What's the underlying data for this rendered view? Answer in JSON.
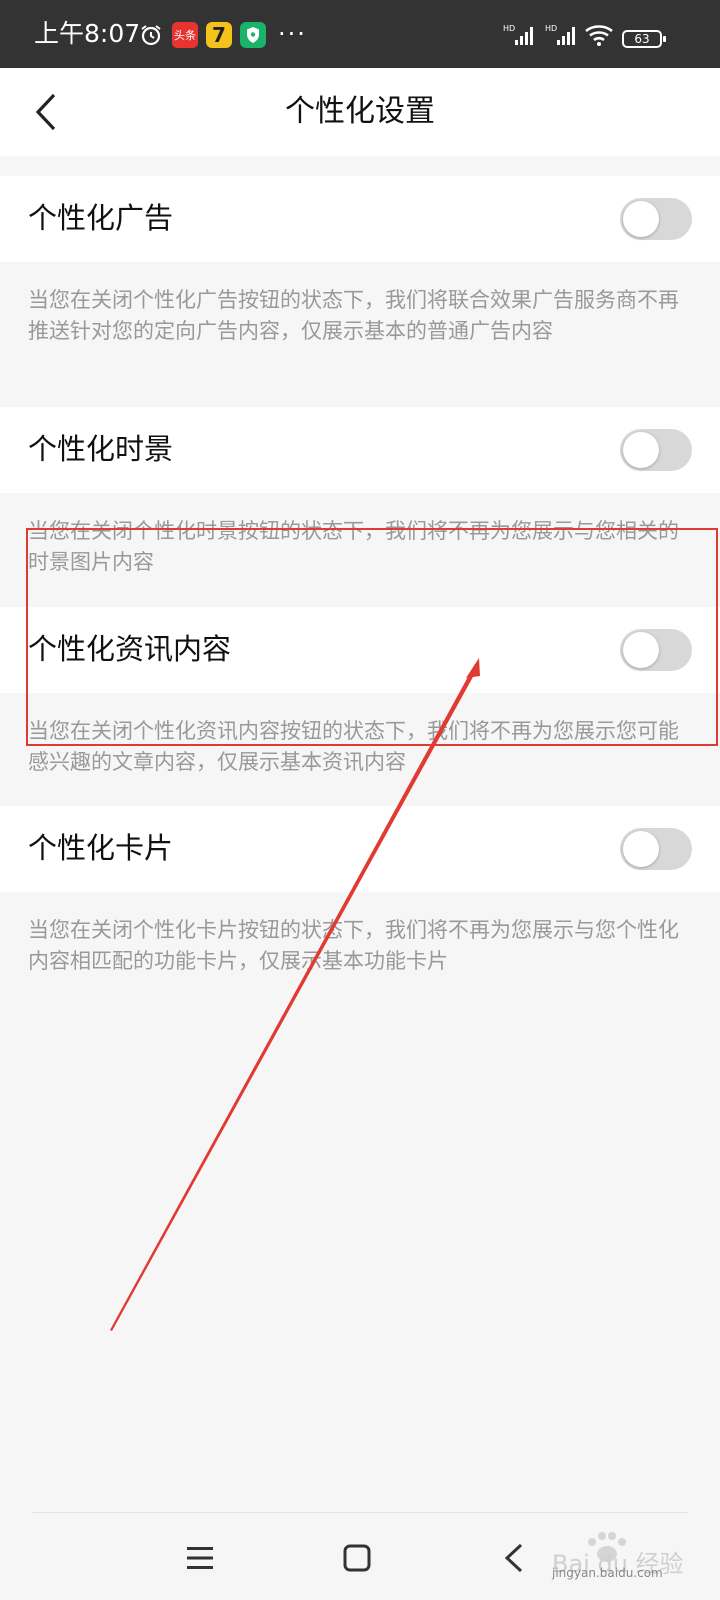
{
  "status_bar": {
    "time": "上午8:07",
    "app_badge": "头条",
    "app_badge2": "7",
    "more": "···",
    "battery": "63",
    "icons": [
      "alarm-icon",
      "toutiao-app-icon",
      "qimao-app-icon",
      "shield-app-icon",
      "signal-hd-icon",
      "signal-hd-icon",
      "wifi-icon",
      "battery-icon"
    ]
  },
  "header": {
    "title": "个性化设置",
    "back_icon": "chevron-left-icon"
  },
  "settings": [
    {
      "label": "个性化广告",
      "enabled": false,
      "description": "当您在关闭个性化广告按钮的状态下，我们将联合效果广告服务商不再推送针对您的定向广告内容，仅展示基本的普通广告内容"
    },
    {
      "label": "个性化时景",
      "enabled": false,
      "description": "当您在关闭个性化时景按钮的状态下，我们将不再为您展示与您相关的时景图片内容"
    },
    {
      "label": "个性化资讯内容",
      "enabled": false,
      "description": "当您在关闭个性化资讯内容按钮的状态下，我们将不再为您展示您可能感兴趣的文章内容，仅展示基本资讯内容"
    },
    {
      "label": "个性化卡片",
      "enabled": false,
      "description": "当您在关闭个性化卡片按钮的状态下，我们将不再为您展示与您个性化内容相匹配的功能卡片，仅展示基本功能卡片"
    }
  ],
  "nav_bar": {
    "icons": [
      "menu-icon",
      "home-square-icon",
      "back-chevron-icon"
    ]
  },
  "watermark": {
    "brand": "Bai du 经验",
    "url": "jingyan.baidu.com"
  },
  "colors": {
    "status_bar": "#333333",
    "background": "#f6f6f6",
    "toggle_off": "#d8d8d8",
    "annotation": "#e03a32",
    "description_text": "#999999"
  }
}
